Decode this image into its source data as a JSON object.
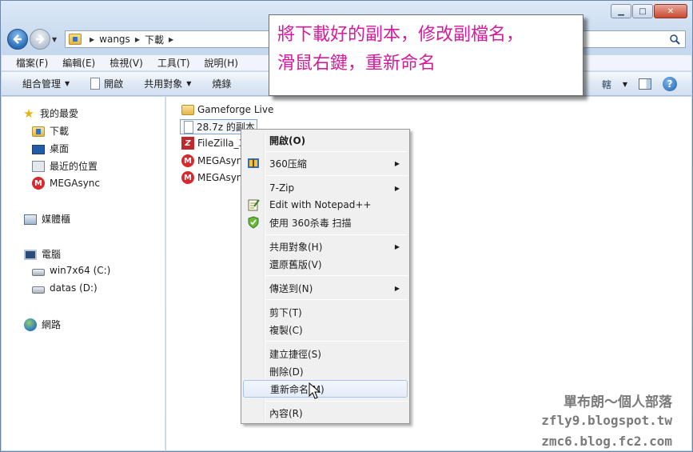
{
  "window": {
    "caption_buttons": {
      "minimize": "▁",
      "maximize": "□",
      "close": "✕"
    }
  },
  "address_bar": {
    "crumbs": [
      "wangs",
      "下載"
    ]
  },
  "menubar": [
    "檔案(F)",
    "編輯(E)",
    "檢視(V)",
    "工具(T)",
    "說明(H)"
  ],
  "commandbar": {
    "organize": "組合管理",
    "open": "開啟",
    "share": "共用對象",
    "burn": "燒錄",
    "views_partial": "轄",
    "help": "?"
  },
  "navpane": {
    "favorites_header": "我的最愛",
    "favorites": [
      "下載",
      "桌面",
      "最近的位置",
      "MEGAsync"
    ],
    "libraries": "媒體櫃",
    "computer": "電腦",
    "drives": [
      "win7x64 (C:)",
      "datas (D:)"
    ],
    "network": "網路"
  },
  "files": [
    {
      "name": "Gameforge Live",
      "icon": "folder-icon"
    },
    {
      "name": "28.7z 的副本",
      "icon": "file-icon",
      "selected": true
    },
    {
      "name": "FileZilla_3.",
      "icon": "filezilla-icon"
    },
    {
      "name": "MEGAsync",
      "icon": "megasync-icon"
    },
    {
      "name": "MEGAsync",
      "icon": "megasync-icon"
    }
  ],
  "annotation": {
    "line1": "將下載好的副本，修改副檔名，",
    "line2": "滑鼠右鍵，重新命名"
  },
  "context_menu": {
    "open": "開啟(O)",
    "compress360": "360压縮",
    "zip7": "7-Zip",
    "notepad": "Edit with Notepad++",
    "scan360": "使用 360杀毒 扫描",
    "share": "共用對象(H)",
    "restore": "還原舊版(V)",
    "sendto": "傳送到(N)",
    "cut": "剪下(T)",
    "copy": "複製(C)",
    "shortcut": "建立捷徑(S)",
    "delete": "刪除(D)",
    "rename": "重新命名(M)",
    "properties": "內容(R)"
  },
  "watermark": {
    "line1": "單布朗～個人部落",
    "line2": "zfly9.blogspot.tw",
    "line3": "zmc6.blog.fc2.com"
  },
  "colors": {
    "annotation_text": "#d61a9c",
    "accent": "#2a6db9"
  }
}
